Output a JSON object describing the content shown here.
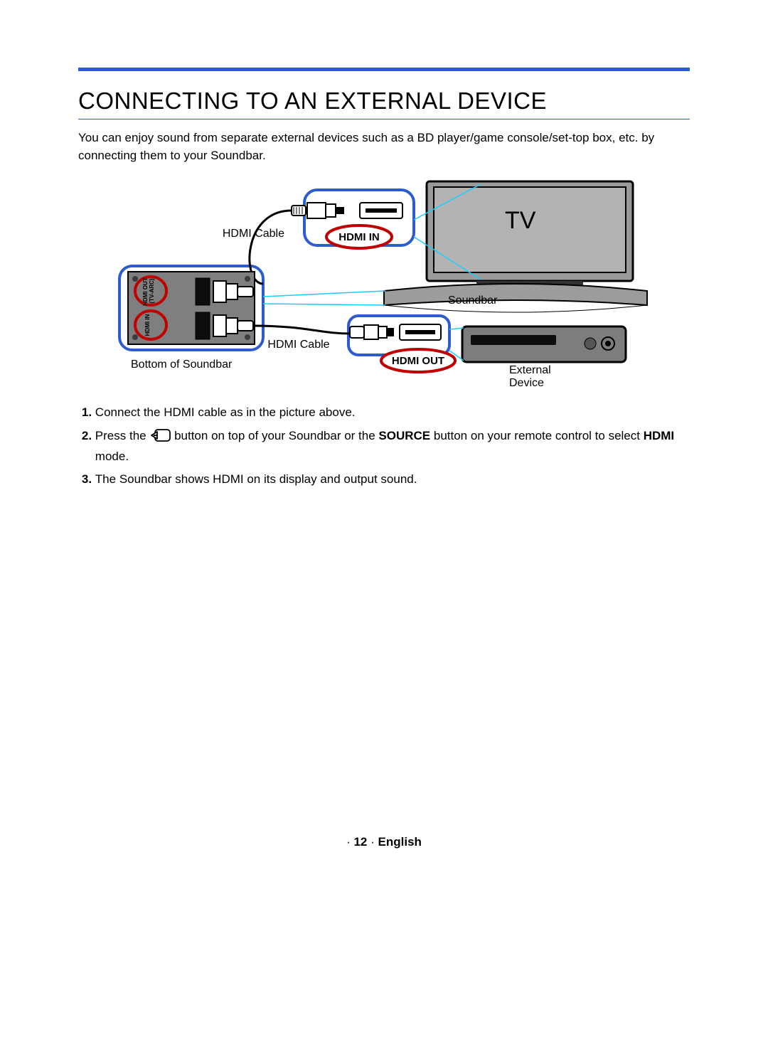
{
  "heading": "CONNECTING TO AN EXTERNAL DEVICE",
  "intro": "You can enjoy sound from separate external devices such as a BD player/game console/set-top box, etc. by connecting them to your Soundbar.",
  "diagram": {
    "tv_label": "TV",
    "hdmi_cable_1": "HDMI Cable",
    "hdmi_cable_2": "HDMI Cable",
    "hdmi_in": "HDMI IN",
    "hdmi_out": "HDMI OUT",
    "soundbar_label": "Soundbar",
    "bottom_label": "Bottom of Soundbar",
    "external_label_1": "External",
    "external_label_2": "Device",
    "port_hdmi_out_l1": "HDMI OUT",
    "port_hdmi_out_l2": "(TV-ARC)",
    "port_hdmi_in": "HDMI IN"
  },
  "steps": {
    "s1": "Connect the HDMI cable as in the picture above.",
    "s2_a": "Press the ",
    "s2_b": " button on top of your Soundbar or the ",
    "s2_source": "SOURCE",
    "s2_c": " button on your remote control to select ",
    "s2_hdmi": "HDMI",
    "s2_d": " mode.",
    "s3": "The Soundbar shows HDMI on its display and output sound."
  },
  "footer": {
    "sep": "·",
    "page": "12",
    "lang": "English"
  }
}
